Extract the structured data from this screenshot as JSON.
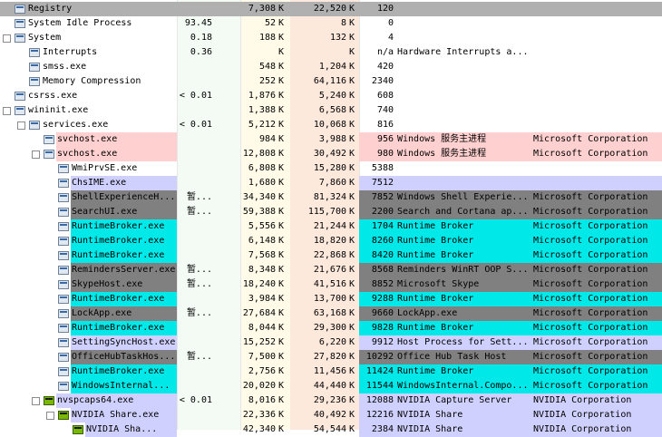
{
  "colors": {
    "service": "#ffd0d0",
    "immersive": "#00e8e8",
    "suspended": "#808080",
    "own": "#d0d0ff",
    "selected": "#b0b0b0",
    "plain": "#ffffff"
  },
  "rows": [
    {
      "name": "Registry",
      "cpu": "",
      "private": "7,308",
      "pu": "K",
      "working": "22,520",
      "wu": "K",
      "pid": "120",
      "desc": "",
      "company": "",
      "indent": 0,
      "tree": "",
      "bg": "selected"
    },
    {
      "name": "System Idle Process",
      "cpu": "93.45",
      "private": "52",
      "pu": "K",
      "working": "8",
      "wu": "K",
      "pid": "0",
      "desc": "",
      "company": "",
      "indent": 0,
      "tree": "",
      "bg": "plain"
    },
    {
      "name": "System",
      "cpu": "0.18",
      "private": "188",
      "pu": "K",
      "working": "132",
      "wu": "K",
      "pid": "4",
      "desc": "",
      "company": "",
      "indent": 0,
      "tree": "−",
      "bg": "plain"
    },
    {
      "name": "Interrupts",
      "cpu": "0.36",
      "private": "",
      "pu": "K",
      "working": "",
      "wu": "K",
      "pid": "n/a",
      "desc": "Hardware Interrupts a...",
      "company": "",
      "indent": 1,
      "tree": "",
      "bg": "plain"
    },
    {
      "name": "smss.exe",
      "cpu": "",
      "private": "548",
      "pu": "K",
      "working": "1,204",
      "wu": "K",
      "pid": "420",
      "desc": "",
      "company": "",
      "indent": 1,
      "tree": "",
      "bg": "plain"
    },
    {
      "name": "Memory Compression",
      "cpu": "",
      "private": "252",
      "pu": "K",
      "working": "64,116",
      "wu": "K",
      "pid": "2340",
      "desc": "",
      "company": "",
      "indent": 1,
      "tree": "",
      "bg": "plain"
    },
    {
      "name": "csrss.exe",
      "cpu": "< 0.01",
      "private": "1,876",
      "pu": "K",
      "working": "5,240",
      "wu": "K",
      "pid": "608",
      "desc": "",
      "company": "",
      "indent": 0,
      "tree": "",
      "bg": "plain"
    },
    {
      "name": "wininit.exe",
      "cpu": "",
      "private": "1,388",
      "pu": "K",
      "working": "6,568",
      "wu": "K",
      "pid": "740",
      "desc": "",
      "company": "",
      "indent": 0,
      "tree": "−",
      "bg": "plain"
    },
    {
      "name": "services.exe",
      "cpu": "< 0.01",
      "private": "5,212",
      "pu": "K",
      "working": "10,068",
      "wu": "K",
      "pid": "816",
      "desc": "",
      "company": "",
      "indent": 1,
      "tree": "−",
      "bg": "plain"
    },
    {
      "name": "svchost.exe",
      "cpu": "",
      "private": "984",
      "pu": "K",
      "working": "3,988",
      "wu": "K",
      "pid": "956",
      "desc": "Windows 服务主进程",
      "company": "Microsoft Corporation",
      "indent": 2,
      "tree": "",
      "bg": "service"
    },
    {
      "name": "svchost.exe",
      "cpu": "",
      "private": "12,808",
      "pu": "K",
      "working": "30,492",
      "wu": "K",
      "pid": "980",
      "desc": "Windows 服务主进程",
      "company": "Microsoft Corporation",
      "indent": 2,
      "tree": "−",
      "bg": "service"
    },
    {
      "name": "WmiPrvSE.exe",
      "cpu": "",
      "private": "6,808",
      "pu": "K",
      "working": "15,280",
      "wu": "K",
      "pid": "5388",
      "desc": "",
      "company": "",
      "indent": 3,
      "tree": "",
      "bg": "plain"
    },
    {
      "name": "ChsIME.exe",
      "cpu": "",
      "private": "1,680",
      "pu": "K",
      "working": "7,860",
      "wu": "K",
      "pid": "7512",
      "desc": "",
      "company": "",
      "indent": 3,
      "tree": "",
      "bg": "own"
    },
    {
      "name": "ShellExperienceH...",
      "cpu": "暂...",
      "private": "34,340",
      "pu": "K",
      "working": "81,324",
      "wu": "K",
      "pid": "7852",
      "desc": "Windows Shell Experie...",
      "company": "Microsoft Corporation",
      "indent": 3,
      "tree": "",
      "bg": "suspended"
    },
    {
      "name": "SearchUI.exe",
      "cpu": "暂...",
      "private": "59,388",
      "pu": "K",
      "working": "115,700",
      "wu": "K",
      "pid": "2200",
      "desc": "Search and Cortana ap...",
      "company": "Microsoft Corporation",
      "indent": 3,
      "tree": "",
      "bg": "suspended"
    },
    {
      "name": "RuntimeBroker.exe",
      "cpu": "",
      "private": "5,556",
      "pu": "K",
      "working": "21,244",
      "wu": "K",
      "pid": "1704",
      "desc": "Runtime Broker",
      "company": "Microsoft Corporation",
      "indent": 3,
      "tree": "",
      "bg": "immersive"
    },
    {
      "name": "RuntimeBroker.exe",
      "cpu": "",
      "private": "6,148",
      "pu": "K",
      "working": "18,820",
      "wu": "K",
      "pid": "8260",
      "desc": "Runtime Broker",
      "company": "Microsoft Corporation",
      "indent": 3,
      "tree": "",
      "bg": "immersive"
    },
    {
      "name": "RuntimeBroker.exe",
      "cpu": "",
      "private": "7,568",
      "pu": "K",
      "working": "22,868",
      "wu": "K",
      "pid": "8420",
      "desc": "Runtime Broker",
      "company": "Microsoft Corporation",
      "indent": 3,
      "tree": "",
      "bg": "immersive"
    },
    {
      "name": "RemindersServer.exe",
      "cpu": "暂...",
      "private": "8,348",
      "pu": "K",
      "working": "21,676",
      "wu": "K",
      "pid": "8568",
      "desc": "Reminders WinRT OOP S...",
      "company": "Microsoft Corporation",
      "indent": 3,
      "tree": "",
      "bg": "suspended"
    },
    {
      "name": "SkypeHost.exe",
      "cpu": "暂...",
      "private": "18,240",
      "pu": "K",
      "working": "41,516",
      "wu": "K",
      "pid": "8852",
      "desc": "Microsoft Skype",
      "company": "Microsoft Corporation",
      "indent": 3,
      "tree": "",
      "bg": "suspended"
    },
    {
      "name": "RuntimeBroker.exe",
      "cpu": "",
      "private": "3,984",
      "pu": "K",
      "working": "13,700",
      "wu": "K",
      "pid": "9288",
      "desc": "Runtime Broker",
      "company": "Microsoft Corporation",
      "indent": 3,
      "tree": "",
      "bg": "immersive"
    },
    {
      "name": "LockApp.exe",
      "cpu": "暂...",
      "private": "27,684",
      "pu": "K",
      "working": "63,168",
      "wu": "K",
      "pid": "9660",
      "desc": "LockApp.exe",
      "company": "Microsoft Corporation",
      "indent": 3,
      "tree": "",
      "bg": "suspended"
    },
    {
      "name": "RuntimeBroker.exe",
      "cpu": "",
      "private": "8,044",
      "pu": "K",
      "working": "29,300",
      "wu": "K",
      "pid": "9828",
      "desc": "Runtime Broker",
      "company": "Microsoft Corporation",
      "indent": 3,
      "tree": "",
      "bg": "immersive"
    },
    {
      "name": "SettingSyncHost.exe",
      "cpu": "",
      "private": "15,252",
      "pu": "K",
      "working": "6,220",
      "wu": "K",
      "pid": "9912",
      "desc": "Host Process for Sett...",
      "company": "Microsoft Corporation",
      "indent": 3,
      "tree": "",
      "bg": "own"
    },
    {
      "name": "OfficeHubTaskHos...",
      "cpu": "暂...",
      "private": "7,500",
      "pu": "K",
      "working": "27,820",
      "wu": "K",
      "pid": "10292",
      "desc": "Office Hub Task Host",
      "company": "Microsoft Corporation",
      "indent": 3,
      "tree": "",
      "bg": "suspended"
    },
    {
      "name": "RuntimeBroker.exe",
      "cpu": "",
      "private": "2,756",
      "pu": "K",
      "working": "11,456",
      "wu": "K",
      "pid": "11424",
      "desc": "Runtime Broker",
      "company": "Microsoft Corporation",
      "indent": 3,
      "tree": "",
      "bg": "immersive"
    },
    {
      "name": "WindowsInternal...",
      "cpu": "",
      "private": "20,020",
      "pu": "K",
      "working": "44,440",
      "wu": "K",
      "pid": "11544",
      "desc": "WindowsInternal.Compo...",
      "company": "Microsoft Corporation",
      "indent": 3,
      "tree": "",
      "bg": "immersive"
    },
    {
      "name": "nvspcaps64.exe",
      "cpu": "< 0.01",
      "private": "8,016",
      "pu": "K",
      "working": "29,236",
      "wu": "K",
      "pid": "12088",
      "desc": "NVIDIA Capture Server",
      "company": "NVIDIA Corporation",
      "indent": 2,
      "tree": "−",
      "bg": "own",
      "icon": "nvidia"
    },
    {
      "name": "NVIDIA Share.exe",
      "cpu": "",
      "private": "22,336",
      "pu": "K",
      "working": "40,492",
      "wu": "K",
      "pid": "12216",
      "desc": "NVIDIA Share",
      "company": "NVIDIA Corporation",
      "indent": 3,
      "tree": "−",
      "bg": "own",
      "icon": "nvidia"
    },
    {
      "name": "NVIDIA Sha...",
      "cpu": "",
      "private": "42,340",
      "pu": "K",
      "working": "54,544",
      "wu": "K",
      "pid": "2384",
      "desc": "NVIDIA Share",
      "company": "NVIDIA Corporation",
      "indent": 4,
      "tree": "",
      "bg": "own",
      "icon": "nvidia"
    }
  ]
}
